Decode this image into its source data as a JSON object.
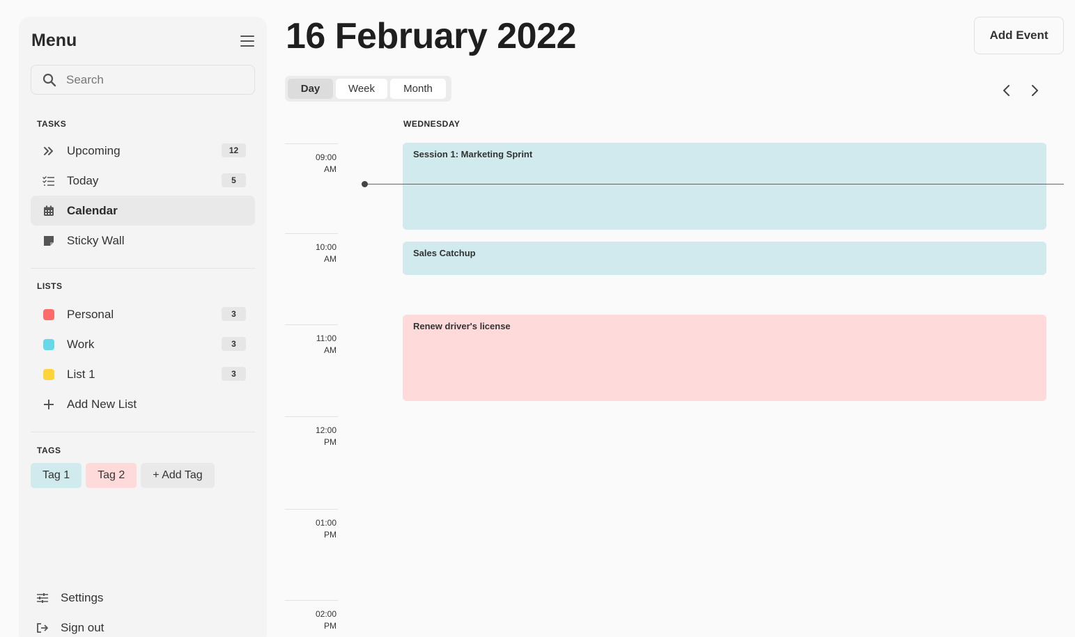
{
  "sidebar": {
    "title": "Menu",
    "search_placeholder": "Search",
    "tasks_label": "TASKS",
    "tasks": [
      {
        "label": "Upcoming",
        "count": "12",
        "icon": "double-chevron-right-icon"
      },
      {
        "label": "Today",
        "count": "5",
        "icon": "checklist-icon"
      },
      {
        "label": "Calendar",
        "count": null,
        "icon": "calendar-icon",
        "active": true
      },
      {
        "label": "Sticky Wall",
        "count": null,
        "icon": "sticky-note-icon"
      }
    ],
    "lists_label": "LISTS",
    "lists": [
      {
        "label": "Personal",
        "count": "3",
        "color": "#ff6b6b"
      },
      {
        "label": "Work",
        "count": "3",
        "color": "#66d9e8"
      },
      {
        "label": "List 1",
        "count": "3",
        "color": "#ffd43b"
      }
    ],
    "add_list_label": "Add New List",
    "tags_label": "TAGS",
    "tags": [
      {
        "label": "Tag 1",
        "color": "#d1eaed"
      },
      {
        "label": "Tag 2",
        "color": "#ffdada"
      }
    ],
    "add_tag_label": "+ Add Tag",
    "settings_label": "Settings",
    "signout_label": "Sign out"
  },
  "main": {
    "title": "16 February 2022",
    "add_event_label": "Add Event",
    "views": [
      "Day",
      "Week",
      "Month"
    ],
    "active_view": "Day",
    "day_label": "WEDNESDAY",
    "times": [
      {
        "time": "09:00",
        "period": "AM"
      },
      {
        "time": "10:00",
        "period": "AM"
      },
      {
        "time": "11:00",
        "period": "AM"
      },
      {
        "time": "12:00",
        "period": "PM"
      },
      {
        "time": "01:00",
        "period": "PM"
      },
      {
        "time": "02:00",
        "period": "PM"
      }
    ],
    "events": [
      {
        "title": "Session 1: Marketing Sprint",
        "color": "#d1eaed"
      },
      {
        "title": "Sales Catchup",
        "color": "#d1eaed"
      },
      {
        "title": "Renew driver's license",
        "color": "#ffdada"
      }
    ]
  }
}
